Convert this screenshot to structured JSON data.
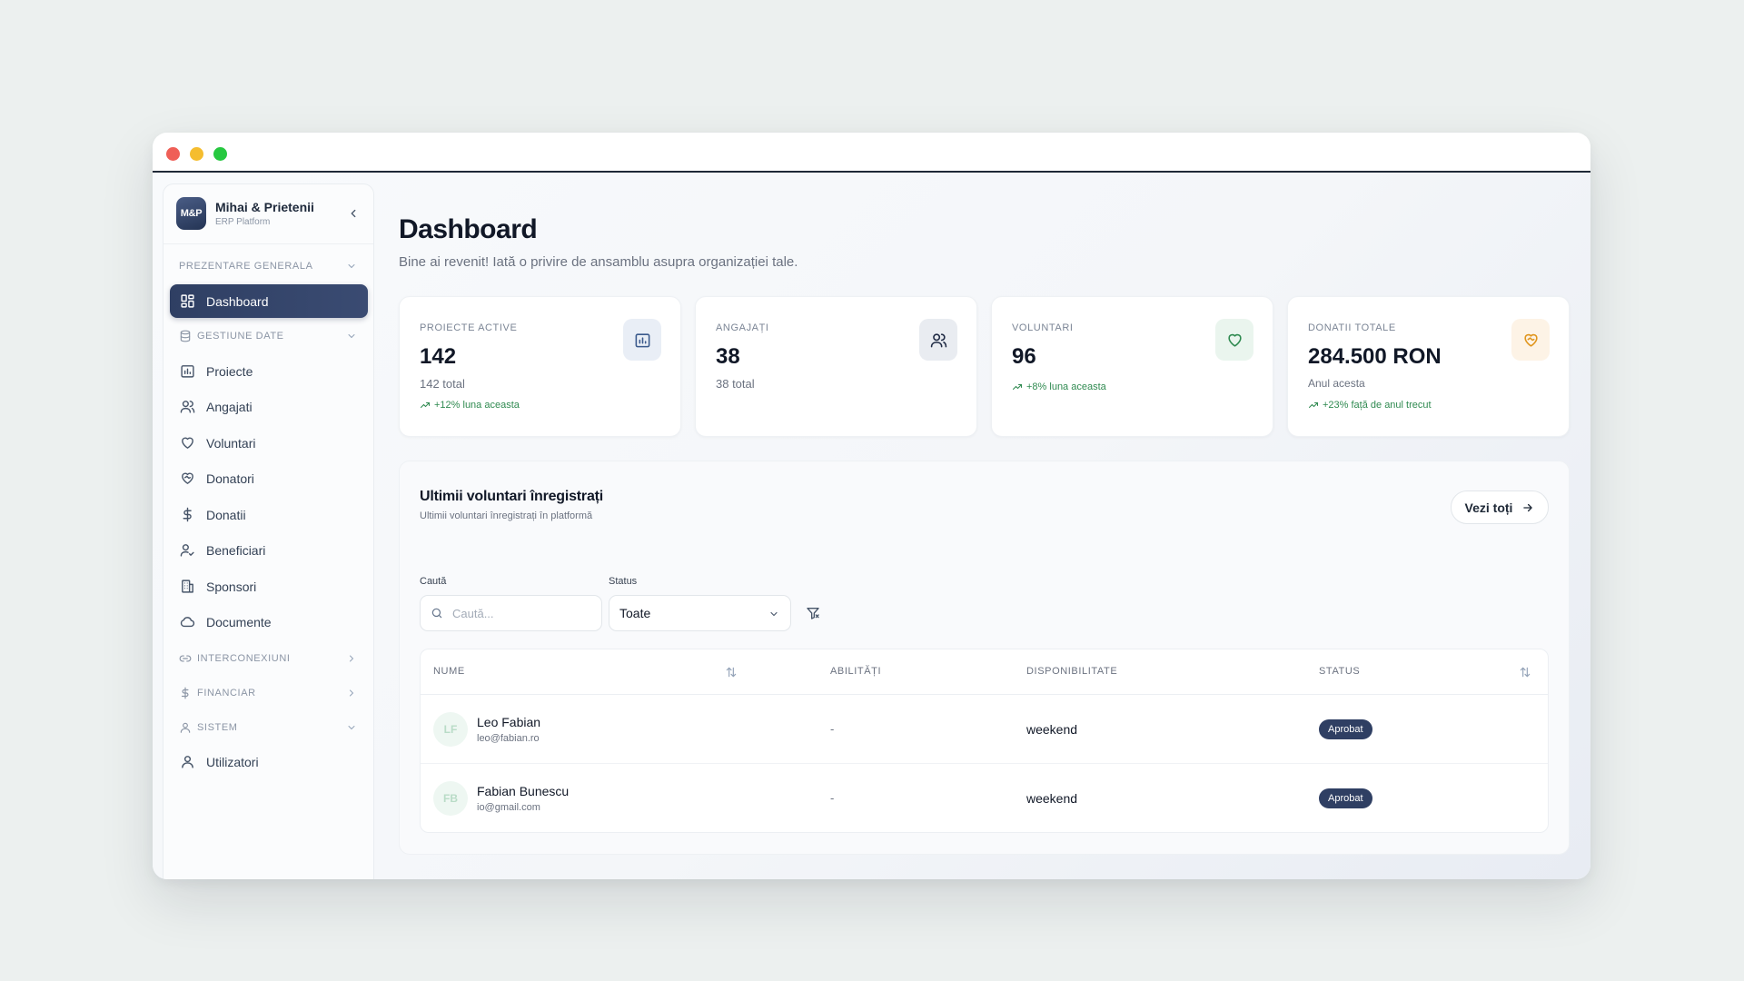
{
  "brand": {
    "logo": "M&P",
    "name": "Mihai & Prietenii",
    "subtitle": "ERP Platform"
  },
  "sidebar": {
    "sections": [
      {
        "label": "PREZENTARE GENERALA"
      },
      {
        "label": "GESTIUNE DATE"
      },
      {
        "label": "INTERCONEXIUNI"
      },
      {
        "label": "FINANCIAR"
      },
      {
        "label": "SISTEM"
      }
    ],
    "items": [
      {
        "label": "Dashboard",
        "icon": "dashboard-icon"
      },
      {
        "label": "Proiecte",
        "icon": "chart-icon"
      },
      {
        "label": "Angajati",
        "icon": "users-icon"
      },
      {
        "label": "Voluntari",
        "icon": "heart-icon"
      },
      {
        "label": "Donatori",
        "icon": "heart-handshake-icon"
      },
      {
        "label": "Donatii",
        "icon": "dollar-icon"
      },
      {
        "label": "Beneficiari",
        "icon": "user-check-icon"
      },
      {
        "label": "Sponsori",
        "icon": "building-icon"
      },
      {
        "label": "Documente",
        "icon": "cloud-icon"
      },
      {
        "label": "Utilizatori",
        "icon": "user-icon"
      }
    ]
  },
  "header": {
    "title": "Dashboard",
    "subtitle": "Bine ai revenit! Iată o privire de ansamblu asupra organizației tale."
  },
  "stats": [
    {
      "label": "PROIECTE ACTIVE",
      "value": "142",
      "total": "142 total",
      "trend": "+12% luna aceasta",
      "icon": "chart-icon",
      "accent": "#e9eef6"
    },
    {
      "label": "ANGAJAȚI",
      "value": "38",
      "total": "38 total",
      "trend": "",
      "icon": "users-icon",
      "accent": "#e9ecf1"
    },
    {
      "label": "VOLUNTARI",
      "value": "96",
      "total": "",
      "trend": "+8% luna aceasta",
      "icon": "heart-icon",
      "accent": "#eaf5ee"
    },
    {
      "label": "DONATII TOTALE",
      "value": "284.500 RON",
      "total": "Anul acesta",
      "trend": "+23% față de anul trecut",
      "icon": "heart-handshake-icon",
      "accent": "#fdf3e6"
    }
  ],
  "panel": {
    "title": "Ultimii voluntari înregistrați",
    "subtitle": "Ultimii voluntari înregistrați în platformă",
    "view_all": "Vezi toți",
    "search_label": "Caută",
    "search_placeholder": "Caută...",
    "status_label": "Status",
    "status_value": "Toate",
    "columns": [
      "NUME",
      "ABILITĂȚI",
      "DISPONIBILITATE",
      "STATUS"
    ],
    "rows": [
      {
        "initials": "LF",
        "name": "Leo Fabian",
        "email": "leo@fabian.ro",
        "skills": "-",
        "availability": "weekend",
        "status": "Aprobat"
      },
      {
        "initials": "FB",
        "name": "Fabian Bunescu",
        "email": "io@gmail.com",
        "skills": "-",
        "availability": "weekend",
        "status": "Aprobat"
      }
    ]
  },
  "colors": {
    "accent": "#2f3f63",
    "success": "#2f8a50",
    "background": "#ecf0ef"
  }
}
